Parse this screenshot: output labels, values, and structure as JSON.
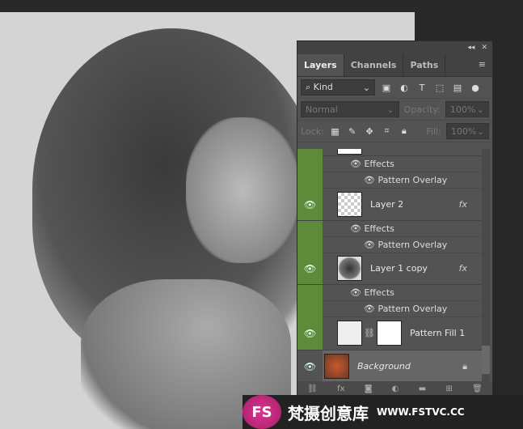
{
  "panel": {
    "tabs": [
      "Layers",
      "Channels",
      "Paths"
    ],
    "filter": {
      "label": "Kind",
      "icons": [
        "image-icon",
        "adjustment-icon",
        "type-icon",
        "shape-icon",
        "smart-object-icon"
      ]
    },
    "blend_mode": "Normal",
    "opacity_label": "Opacity:",
    "opacity": "100%",
    "lock_label": "Lock:",
    "fill_label": "Fill:",
    "fill": "100%"
  },
  "layers": [
    {
      "name": "",
      "effects": "Effects",
      "effect": "Pattern Overlay"
    },
    {
      "name": "Layer 2",
      "fx": "fx",
      "effects": "Effects",
      "effect": "Pattern Overlay"
    },
    {
      "name": "Layer 1 copy",
      "fx": "fx",
      "effects": "Effects",
      "effect": "Pattern Overlay"
    },
    {
      "name": "Pattern Fill 1"
    },
    {
      "name": "Background"
    }
  ],
  "watermark": {
    "logo": "FS",
    "text": "梵摄创意库",
    "url": "WWW.FSTVC.CC"
  },
  "colors": {
    "selected_eye": "#5f8a3a",
    "panel": "#535353"
  }
}
